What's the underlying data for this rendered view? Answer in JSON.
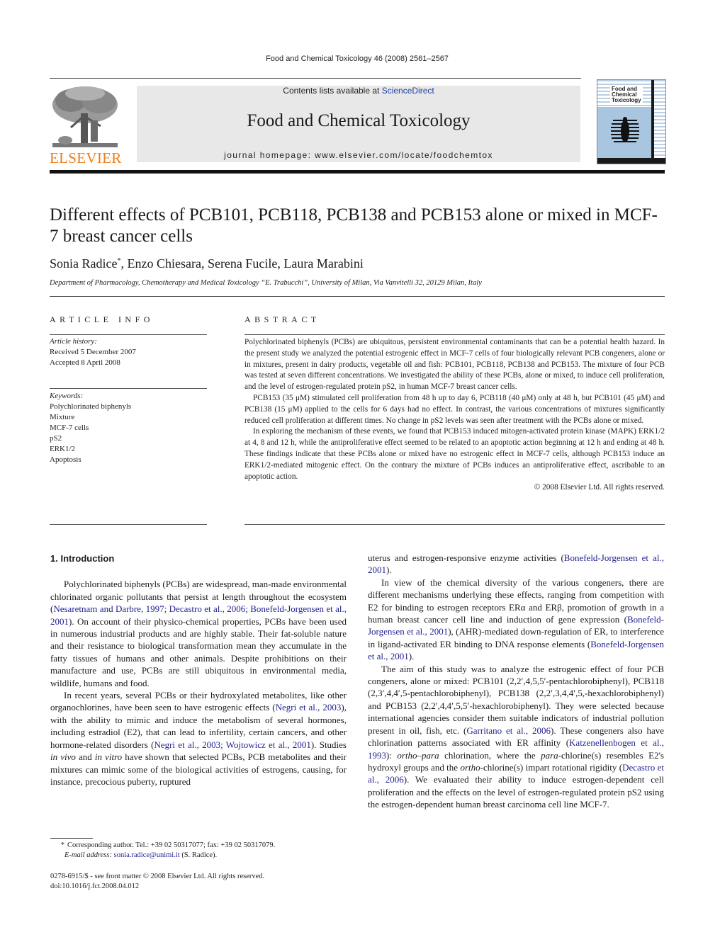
{
  "running_head": "Food and Chemical Toxicology 46 (2008) 2561–2567",
  "header": {
    "publisher_logo_text": "ELSEVIER",
    "contents_prefix": "Contents lists available at ",
    "contents_link": "ScienceDirect",
    "journal_title": "Food and Chemical Toxicology",
    "homepage": "journal homepage: www.elsevier.com/locate/foodchemtox",
    "cover_title": [
      "Food and",
      "Chemical",
      "Toxicology"
    ],
    "colors": {
      "publisher_orange": "#ef7d1a",
      "link_blue": "#1f3f9f",
      "banner_gray": "#e8e8e8",
      "cover_blue": "#a9c6e0"
    }
  },
  "article": {
    "title": "Different effects of PCB101, PCB118, PCB138 and PCB153 alone or mixed in MCF-7 breast cancer cells",
    "authors_first": "Sonia Radice",
    "authors_mark": "*",
    "authors_rest": ", Enzo Chiesara, Serena Fucile, Laura Marabini",
    "affiliation": "Department of Pharmacology, Chemotherapy and Medical Toxicology “E. Trabucchi”, University of Milan, Via Vanvitelli 32, 20129 Milan, Italy"
  },
  "article_info": {
    "heading": "ARTICLE INFO",
    "history_label": "Article history:",
    "received": "Received 5 December 2007",
    "accepted": "Accepted 8 April 2008",
    "keywords_label": "Keywords:",
    "keywords": [
      "Polychlorinated biphenyls",
      "Mixture",
      "MCF-7 cells",
      "pS2",
      "ERK1/2",
      "Apoptosis"
    ]
  },
  "abstract": {
    "heading": "ABSTRACT",
    "paragraphs": [
      "Polychlorinated biphenyls (PCBs) are ubiquitous, persistent environmental contaminants that can be a potential health hazard. In the present study we analyzed the potential estrogenic effect in MCF-7 cells of four biologically relevant PCB congeners, alone or in mixtures, present in dairy products, vegetable oil and fish: PCB101, PCB118, PCB138 and PCB153. The mixture of four PCB was tested at seven different concentrations. We investigated the ability of these PCBs, alone or mixed, to induce cell proliferation, and the level of estrogen-regulated protein pS2, in human MCF-7 breast cancer cells.",
      "PCB153 (35 μM) stimulated cell proliferation from 48 h up to day 6, PCB118 (40 μM) only at 48 h, but PCB101 (45 μM) and PCB138 (15 μM) applied to the cells for 6 days had no effect. In contrast, the various concentrations of mixtures significantly reduced cell proliferation at different times. No change in pS2 levels was seen after treatment with the PCBs alone or mixed.",
      "In exploring the mechanism of these events, we found that PCB153 induced mitogen-activated protein kinase (MAPK) ERK1/2 at 4, 8 and 12 h, while the antiproliferative effect seemed to be related to an apoptotic action beginning at 12 h and ending at 48 h. These findings indicate that these PCBs alone or mixed have no estrogenic effect in MCF-7 cells, although PCB153 induce an ERK1/2-mediated mitogenic effect. On the contrary the mixture of PCBs induces an antiproliferative effect, ascribable to an apoptotic action."
    ],
    "copyright": "© 2008 Elsevier Ltd. All rights reserved."
  },
  "introduction": {
    "heading": "1. Introduction",
    "p1": {
      "a": "Polychlorinated biphenyls (PCBs) are widespread, man-made environmental chlorinated organic pollutants that persist at length throughout the ecosystem (",
      "ref1": "Nesaretnam and Darbre, 1997; Decastro et al., 2006; Bonefeld-Jorgensen et al., 2001",
      "b": "). On account of their physico-chemical properties, PCBs have been used in numerous industrial products and are highly stable. Their fat-soluble nature and their resistance to biological transformation mean they accumulate in the fatty tissues of humans and other animals. Despite prohibitions on their manufacture and use, PCBs are still ubiquitous in environmental media, wildlife, humans and food."
    },
    "p2": {
      "a": "In recent years, several PCBs or their hydroxylated metabolites, like other organochlorines, have been seen to have estrogenic effects (",
      "ref1": "Negri et al., 2003",
      "b": "), with the ability to mimic and induce the metabolism of several hormones, including estradiol (E2), that can lead to infertility, certain cancers, and other hormone-related disorders (",
      "ref2": "Negri et al., 2003; Wojtowicz et al., 2001",
      "c": "). Studies ",
      "it1": "in vivo",
      "d": " and ",
      "it2": "in vitro",
      "e": " have shown that selected PCBs, PCB metabolites and their mixtures can mimic some of the biological activities of estrogens, causing, for instance, precocious puberty, ruptured uterus and estrogen-responsive enzyme activities (",
      "ref3": "Bonefeld-Jorgensen et al., 2001",
      "f": ")."
    },
    "p3": {
      "a": "In view of the chemical diversity of the various congeners, there are different mechanisms underlying these effects, ranging from competition with E2 for binding to estrogen receptors ERα and ERβ, promotion of growth in a human breast cancer cell line and induction of gene expression (",
      "ref1": "Bonefeld-Jorgensen et al., 2001",
      "b": "), (AHR)-mediated down-regulation of ER, to interference in ligand-activated ER binding to DNA response elements (",
      "ref2": "Bonefeld-Jorgensen et al., 2001",
      "c": ")."
    },
    "p4": {
      "a": "The aim of this study was to analyze the estrogenic effect of four PCB congeners, alone or mixed: PCB101 (2,2′,4,5,5′-pentachlorobiphenyl), PCB118 (2,3′,4,4′,5-pentachlorobiphenyl), PCB138 (2,2′,3,4,4′,5,-hexachlorobiphenyl) and PCB153 (2,2′,4,4′,5,5′-hexachlorobiphenyl). They were selected because international agencies consider them suitable indicators of industrial pollution present in oil, fish, etc. (",
      "ref1": "Garritano et al., 2006",
      "b": "). These congeners also have chlorination patterns associated with ER affinity (",
      "ref2": "Katzenellenbogen et al., 1993",
      "c": "): ",
      "it1": "ortho–para",
      "d": " chlorination, where the ",
      "it2": "para",
      "e": "-chlorine(s) resembles E2's hydroxyl groups and the ",
      "it3": "ortho",
      "f": "-chlorine(s) impart rotational rigidity (",
      "ref3": "Decastro et al., 2006",
      "g": "). We evaluated their ability to induce estrogen-dependent cell proliferation and the effects on the level of estrogen-regulated protein pS2 using the estrogen-dependent human breast carcinoma cell line MCF-7."
    }
  },
  "footnote": {
    "mark": "*",
    "corresponding": "Corresponding author. Tel.: +39 02 50317077; fax: +39 02 50317079.",
    "email_label": "E-mail address:",
    "email": "sonia.radice@unimi.it",
    "email_suffix": " (S. Radice)."
  },
  "issn_line": "0278-6915/$ - see front matter © 2008 Elsevier Ltd. All rights reserved.",
  "doi": "doi:10.1016/j.fct.2008.04.012"
}
